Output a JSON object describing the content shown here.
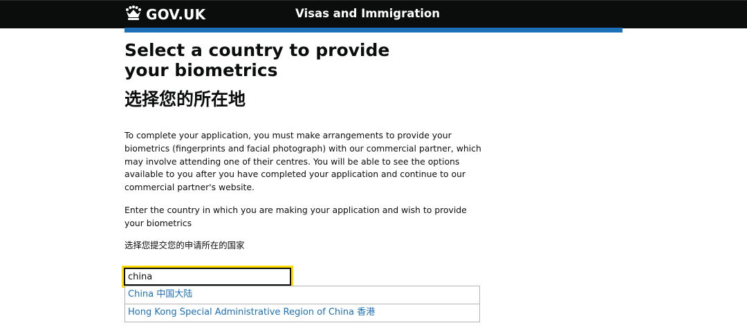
{
  "header": {
    "logo_text": "GOV.UK",
    "service_name": "Visas and Immigration",
    "crown_icon": "crown-icon",
    "background_color": "#0b0c0c",
    "accent_color": "#1d70b8"
  },
  "page": {
    "title": "Select a country to provide your biometrics",
    "title_cn": "选择您的所在地",
    "intro": "To complete your application, you must make arrangements to provide your biometrics (fingerprints and facial photograph) with our commercial partner, which may involve attending one of their centres. You will be able to see the options available to you after you have completed your application and continue to our commercial partner's website.",
    "instruction": "Enter the country in which you are making your application and wish to provide your biometrics",
    "instruction_cn": "选择您提交您的申请所在的国家"
  },
  "search": {
    "value": "china",
    "focus_color": "#ffdd00"
  },
  "suggestions": [
    {
      "label": "China 中国大陆"
    },
    {
      "label": "Hong Kong Special Administrative Region of China 香港"
    }
  ]
}
